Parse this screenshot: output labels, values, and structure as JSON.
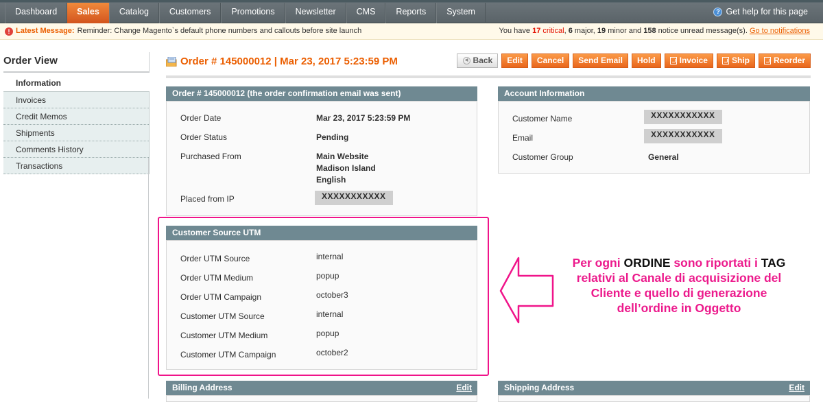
{
  "nav": {
    "items": [
      {
        "label": "Dashboard",
        "active": false
      },
      {
        "label": "Sales",
        "active": true
      },
      {
        "label": "Catalog",
        "active": false
      },
      {
        "label": "Customers",
        "active": false
      },
      {
        "label": "Promotions",
        "active": false
      },
      {
        "label": "Newsletter",
        "active": false
      },
      {
        "label": "CMS",
        "active": false
      },
      {
        "label": "Reports",
        "active": false
      },
      {
        "label": "System",
        "active": false
      }
    ],
    "help_label": "Get help for this page"
  },
  "message_bar": {
    "latest_label": "Latest Message:",
    "latest_text": "Reminder: Change Magento`s default phone numbers and callouts before site launch",
    "summary_prefix": "You have",
    "critical_count": "17",
    "critical_label": "critical",
    "major_count": "6",
    "major_label": "major,",
    "minor_count": "19",
    "minor_label": "minor and",
    "notice_count": "158",
    "notice_label": "notice unread message(s).",
    "link_label": "Go to notifications"
  },
  "sidebar": {
    "title": "Order View",
    "active_item": "Information",
    "items": [
      "Invoices",
      "Credit Memos",
      "Shipments",
      "Comments History",
      "Transactions"
    ]
  },
  "header": {
    "title": "Order # 145000012 | Mar 23, 2017 5:23:59 PM",
    "buttons": {
      "back": "Back",
      "edit": "Edit",
      "cancel": "Cancel",
      "send_email": "Send Email",
      "hold": "Hold",
      "invoice": "Invoice",
      "ship": "Ship",
      "reorder": "Reorder"
    }
  },
  "order_box": {
    "title": "Order # 145000012 (the order confirmation email was sent)",
    "order_date_label": "Order Date",
    "order_date": "Mar 23, 2017 5:23:59 PM",
    "status_label": "Order Status",
    "status": "Pending",
    "purchased_label": "Purchased From",
    "purchased_lines": [
      "Main Website",
      "Madison Island",
      "English"
    ],
    "ip_label": "Placed from IP",
    "ip": "XXXXXXXXXXX"
  },
  "account_box": {
    "title": "Account Information",
    "name_label": "Customer Name",
    "name": "XXXXXXXXXXX",
    "email_label": "Email",
    "email": "XXXXXXXXXXX",
    "group_label": "Customer Group",
    "group": "General"
  },
  "utm_box": {
    "title": "Customer Source UTM",
    "rows": [
      {
        "label": "Order UTM Source",
        "value": "internal"
      },
      {
        "label": "Order UTM Medium",
        "value": "popup"
      },
      {
        "label": "Order UTM Campaign",
        "value": "october3"
      },
      {
        "label": "Customer UTM Source",
        "value": "internal"
      },
      {
        "label": "Customer UTM Medium",
        "value": "popup"
      },
      {
        "label": "Customer UTM Campaign",
        "value": "october2"
      }
    ]
  },
  "billing": {
    "title": "Billing Address",
    "edit": "Edit"
  },
  "shipping": {
    "title": "Shipping Address",
    "edit": "Edit"
  },
  "annotation": {
    "line1_a": "Per ogni",
    "line1_b": "ORDINE",
    "line1_c": "sono riportati i",
    "line1_d": "TAG",
    "line2": "relativi al Canale di acquisizione del",
    "line3": "Cliente e quello di generazione",
    "line4": "dell’ordine in Oggetto",
    "color": "#ec1a8c"
  }
}
